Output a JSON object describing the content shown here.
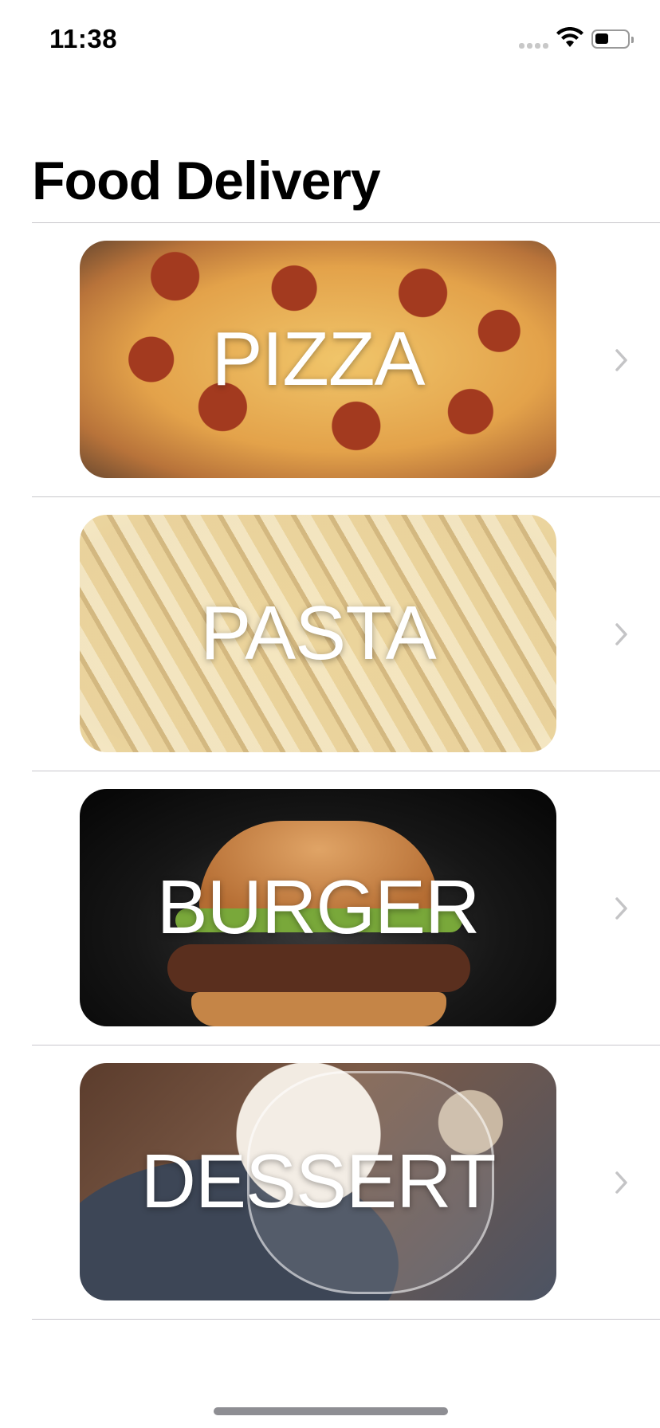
{
  "status_bar": {
    "time": "11:38"
  },
  "nav": {
    "title": "Food Delivery"
  },
  "categories": [
    {
      "label": "PIZZA",
      "image": "pizza-photo"
    },
    {
      "label": "PASTA",
      "image": "pasta-photo"
    },
    {
      "label": "BURGER",
      "image": "burger-photo"
    },
    {
      "label": "DESSERT",
      "image": "dessert-photo"
    }
  ],
  "icons": {
    "signal": "cellular-signal-icon",
    "wifi": "wifi-icon",
    "battery": "battery-icon",
    "row_chevron": "chevron-right-icon"
  },
  "colors": {
    "separator": "#c8c7cc",
    "chevron": "#c4c4c6",
    "label_text": "#ffffff"
  }
}
